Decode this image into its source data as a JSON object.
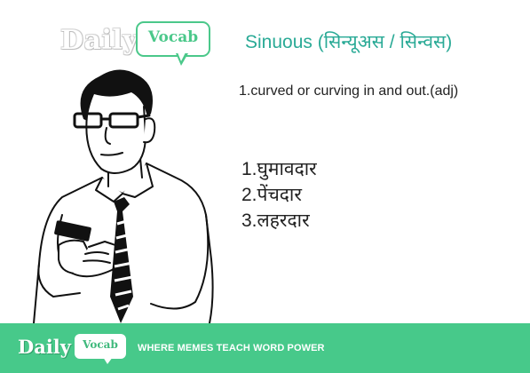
{
  "brand": {
    "daily": "Daily",
    "vocab": "Vocab",
    "accent": "#47c98a"
  },
  "word": {
    "title": "Sinuous (सिन्यूअस  /  सिन्वस)"
  },
  "definition": "1.curved or curving in and out.(adj)",
  "meanings": [
    "1.घुमावदार",
    "2.पेंचदार",
    "3.लहरदार"
  ],
  "footer": {
    "tagline": "WHERE MEMES TEACH WORD POWER"
  },
  "illustration": {
    "icon": "man-with-glasses-holding-phone"
  }
}
